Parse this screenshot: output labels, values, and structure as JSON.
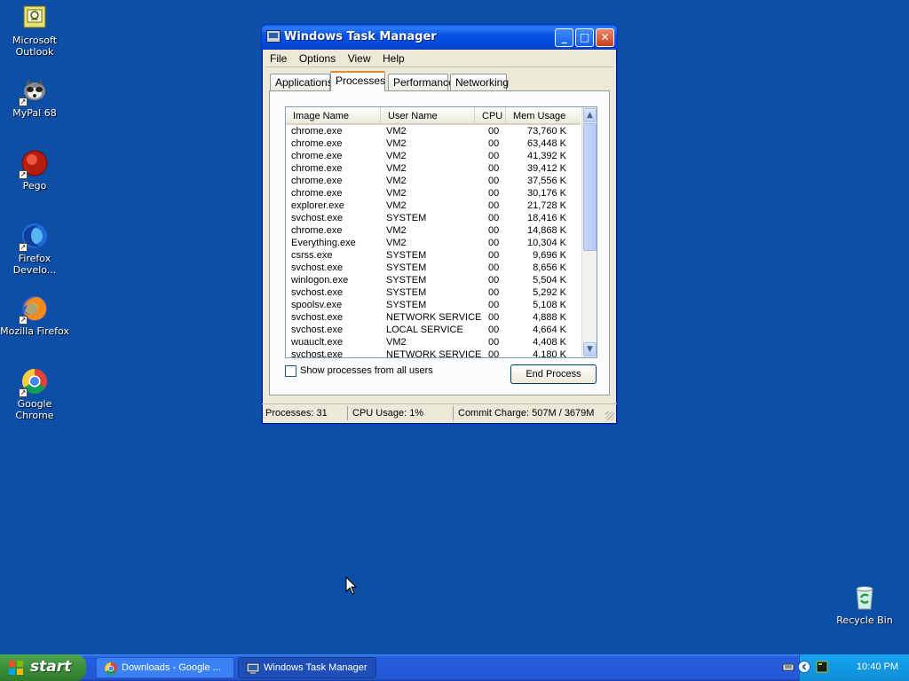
{
  "desktop": {
    "icons": [
      {
        "label": "Microsoft Outlook",
        "icon": "outlook-icon"
      },
      {
        "label": "MyPal 68",
        "icon": "mypal-icon"
      },
      {
        "label": "Pego",
        "icon": "pego-icon"
      },
      {
        "label": "Firefox Develo...",
        "icon": "firefox-developer-icon"
      },
      {
        "label": "Mozilla Firefox",
        "icon": "firefox-icon"
      },
      {
        "label": "Google Chrome",
        "icon": "chrome-icon"
      },
      {
        "label": "Recycle Bin",
        "icon": "recycle-bin-icon"
      }
    ]
  },
  "window": {
    "title": "Windows Task Manager",
    "menu": [
      "File",
      "Options",
      "View",
      "Help"
    ],
    "tabs": [
      "Applications",
      "Processes",
      "Performance",
      "Networking"
    ],
    "active_tab": "Processes",
    "columns": [
      "Image Name",
      "User Name",
      "CPU",
      "Mem Usage"
    ],
    "processes": [
      {
        "name": "chrome.exe",
        "user": "VM2",
        "cpu": "00",
        "mem": "73,760 K"
      },
      {
        "name": "chrome.exe",
        "user": "VM2",
        "cpu": "00",
        "mem": "63,448 K"
      },
      {
        "name": "chrome.exe",
        "user": "VM2",
        "cpu": "00",
        "mem": "41,392 K"
      },
      {
        "name": "chrome.exe",
        "user": "VM2",
        "cpu": "00",
        "mem": "39,412 K"
      },
      {
        "name": "chrome.exe",
        "user": "VM2",
        "cpu": "00",
        "mem": "37,556 K"
      },
      {
        "name": "chrome.exe",
        "user": "VM2",
        "cpu": "00",
        "mem": "30,176 K"
      },
      {
        "name": "explorer.exe",
        "user": "VM2",
        "cpu": "00",
        "mem": "21,728 K"
      },
      {
        "name": "svchost.exe",
        "user": "SYSTEM",
        "cpu": "00",
        "mem": "18,416 K"
      },
      {
        "name": "chrome.exe",
        "user": "VM2",
        "cpu": "00",
        "mem": "14,868 K"
      },
      {
        "name": "Everything.exe",
        "user": "VM2",
        "cpu": "00",
        "mem": "10,304 K"
      },
      {
        "name": "csrss.exe",
        "user": "SYSTEM",
        "cpu": "00",
        "mem": "9,696 K"
      },
      {
        "name": "svchost.exe",
        "user": "SYSTEM",
        "cpu": "00",
        "mem": "8,656 K"
      },
      {
        "name": "winlogon.exe",
        "user": "SYSTEM",
        "cpu": "00",
        "mem": "5,504 K"
      },
      {
        "name": "svchost.exe",
        "user": "SYSTEM",
        "cpu": "00",
        "mem": "5,292 K"
      },
      {
        "name": "spoolsv.exe",
        "user": "SYSTEM",
        "cpu": "00",
        "mem": "5,108 K"
      },
      {
        "name": "svchost.exe",
        "user": "NETWORK SERVICE",
        "cpu": "00",
        "mem": "4,888 K"
      },
      {
        "name": "svchost.exe",
        "user": "LOCAL SERVICE",
        "cpu": "00",
        "mem": "4,664 K"
      },
      {
        "name": "wuauclt.exe",
        "user": "VM2",
        "cpu": "00",
        "mem": "4,408 K"
      },
      {
        "name": "svchost.exe",
        "user": "NETWORK SERVICE",
        "cpu": "00",
        "mem": "4,180 K"
      }
    ],
    "show_all_label": "Show processes from all users",
    "show_all_checked": false,
    "end_process_label": "End Process",
    "status": {
      "processes": "Processes: 31",
      "cpu": "CPU Usage: 1%",
      "commit": "Commit Charge: 507M / 3679M"
    }
  },
  "taskbar": {
    "start_label": "start",
    "buttons": [
      {
        "label": "Downloads - Google ...",
        "icon": "chrome-icon",
        "active": false
      },
      {
        "label": "Windows Task Manager",
        "icon": "task-manager-icon",
        "active": true
      }
    ],
    "clock": "10:40 PM"
  },
  "colors": {
    "desktop": "#0d4ea6",
    "titlebar": "#0554e4",
    "window_face": "#ece9d8",
    "tray": "#0f8ed7",
    "start": "#3c8e3a"
  }
}
